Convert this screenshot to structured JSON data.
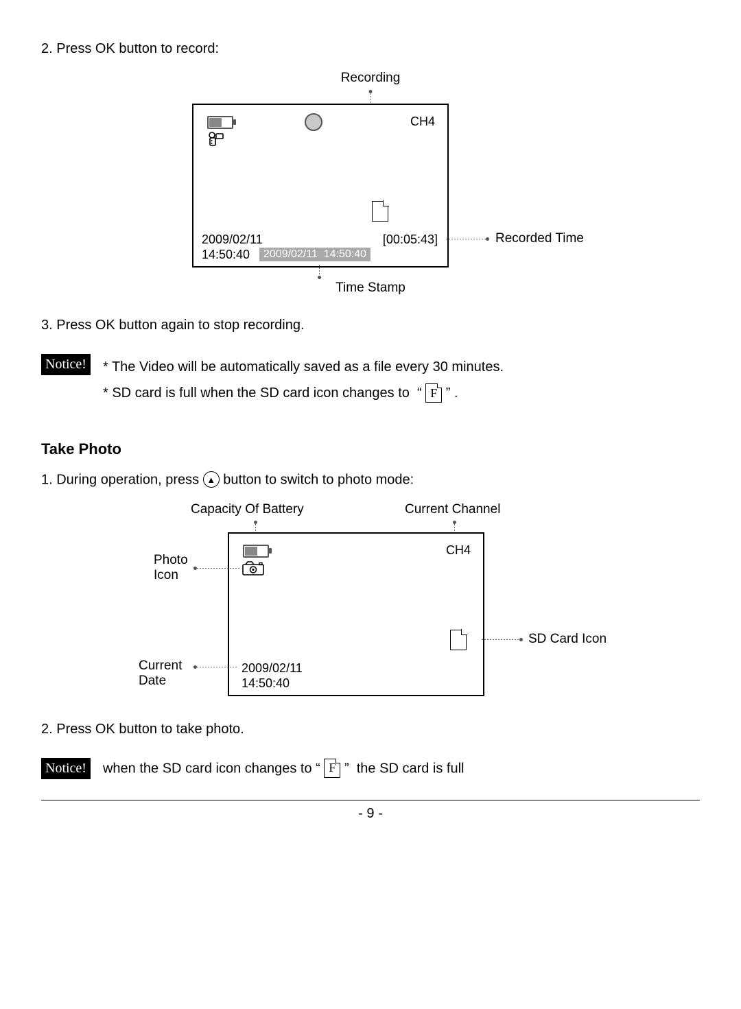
{
  "steps": {
    "s2": "2. Press OK button to record:",
    "s3": "3. Press OK button again to stop recording.",
    "photo_s1_a": "1. During operation, press",
    "photo_s1_b": "button to switch to photo mode:",
    "photo_s2": "2. Press OK button to take photo."
  },
  "section": {
    "take_photo": "Take Photo"
  },
  "notice": {
    "label": "Notice!",
    "line1": "* The Video will be automatically saved as a file every 30 minutes.",
    "line2a": "* SD card is full when the SD card icon changes to  “",
    "line2b": "” .",
    "line3a": "when the SD card icon changes to “",
    "line3b": "”  the SD card is full",
    "f_char": "F"
  },
  "diagram1": {
    "recording_label": "Recording",
    "channel": "CH4",
    "date": "2009/02/11",
    "time": "14:50:40",
    "timestamp_box": "2009/02/11  14:50:40",
    "recorded_time": "[00:05:43]",
    "recorded_time_label": "Recorded Time",
    "time_stamp_label": "Time Stamp"
  },
  "diagram2": {
    "battery_label": "Capacity Of Battery",
    "channel_label": "Current Channel",
    "photo_icon_label_1": "Photo",
    "photo_icon_label_2": "Icon",
    "channel": "CH4",
    "sd_label": "SD Card Icon",
    "date_label_1": "Current",
    "date_label_2": "Date",
    "date": "2009/02/11",
    "time": "14:50:40"
  },
  "page_number": "- 9 -"
}
